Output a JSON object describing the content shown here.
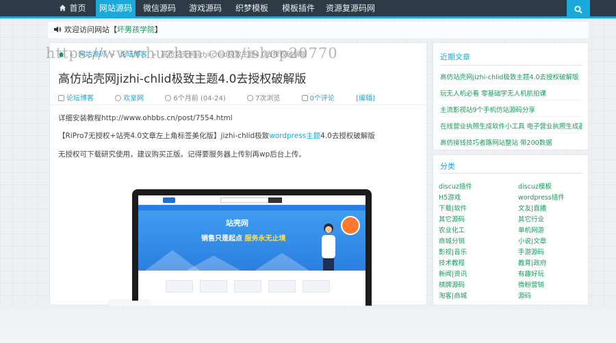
{
  "nav": {
    "items": [
      {
        "label": "首页",
        "active": false
      },
      {
        "label": "网站源码",
        "active": true
      },
      {
        "label": "微信源码",
        "active": false
      },
      {
        "label": "游戏源码",
        "active": false
      },
      {
        "label": "织梦模板",
        "active": false
      },
      {
        "label": "模板插件",
        "active": false
      },
      {
        "label": "资源复源码网",
        "active": false
      }
    ],
    "accent": "#1ba9db",
    "background": "#2e3a45"
  },
  "welcome": {
    "prefix": "欢迎访问网站【",
    "site": "坏男孩学院",
    "suffix": "】"
  },
  "watermark": "https://www.huzhan.com/ishop20770",
  "breadcrumb": {
    "items": [
      "网站源码",
      "论坛博客"
    ],
    "current": "高仿站壳网jizhi-chlid极致主题4.0去授权破解版"
  },
  "article": {
    "title": "高仿站壳网jizhi-chlid极致主题4.0去授权破解版",
    "meta": {
      "category": "论坛博客",
      "author": "欢皇网",
      "time": "6个月前 (04-24)",
      "views": "7次浏览",
      "comments": "0个评论",
      "edit": "[编辑]"
    },
    "para1": "详细安装教程http://www.ohbbs.cn/post/7554.html",
    "para2_a": "【RiPro7无授权+站壳4.0文章左上角标签美化版】jizhi-chlid极致",
    "para2_link": "wordpress主题",
    "para2_b": "4.0去授权破解版",
    "para3": "无授权可下载研究使用，建议购买正版。记得要服务器上传别再wp后台上传。",
    "screenshot": {
      "brand": "站壳网",
      "slogan_a": "销售只是起点",
      "slogan_b": "服务永无止境"
    }
  },
  "sidebar": {
    "recent_title": "近期文章",
    "recent": [
      "高仿站壳网jizhi-chlid极致主题4.0去授权破解版",
      "玩无人机必看 零基础学无人机航拍课",
      "主流影视站9个手机仿站源码分享",
      "在线营业执照生成软件小工具 电子营业执照生成器",
      "高仿接钱技巧者路网站整站 带200数据"
    ],
    "category_title": "分类",
    "categories": [
      [
        "discuz插件",
        "discuz模板"
      ],
      [
        "H5游戏",
        "wordpress插件"
      ],
      [
        "下载|软件",
        "文友|直播"
      ],
      [
        "其它源码",
        "其它行业"
      ],
      [
        "农业化工",
        "单机网游"
      ],
      [
        "商城分销",
        "小说|文章"
      ],
      [
        "影视|音乐",
        "手游源码"
      ],
      [
        "技术教程",
        "教育|政府"
      ],
      [
        "新闻|资讯",
        "有趣好玩"
      ],
      [
        "棋牌源码",
        "微粉营销"
      ],
      [
        "淘客|商城",
        "源码"
      ]
    ],
    "link_color": "#1a9a5a"
  }
}
